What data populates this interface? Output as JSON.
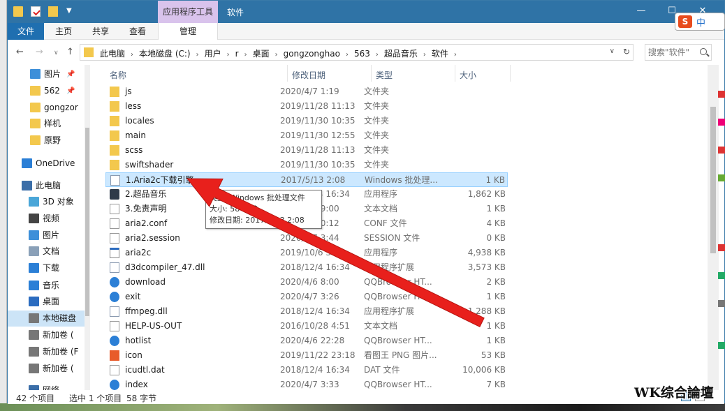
{
  "window": {
    "title": "软件",
    "context_tab": "应用程序工具",
    "minimize_glyph": "—",
    "maximize_glyph": "☐",
    "close_glyph": "✕"
  },
  "ribbon": {
    "tabs": [
      "文件",
      "主页",
      "共享",
      "查看",
      "管理"
    ]
  },
  "ime": {
    "logo": "S",
    "lang": "中"
  },
  "nav": {
    "back": "←",
    "forward": "→",
    "recent": "∨",
    "up": "↑",
    "refresh": "↻",
    "dropdown": "∨"
  },
  "address": {
    "crumbs": [
      "此电脑",
      "本地磁盘 (C:)",
      "用户",
      "r",
      "桌面",
      "gongzonghao",
      "563",
      "超品音乐",
      "软件"
    ],
    "separator": "›"
  },
  "search": {
    "placeholder": "搜索\"软件\""
  },
  "navpane": [
    {
      "label": "图片",
      "pinned": true,
      "icon": "pictures-icon"
    },
    {
      "label": "562",
      "pinned": true,
      "icon": "folder-icon"
    },
    {
      "label": "gongzor",
      "pinned": false,
      "icon": "folder-icon"
    },
    {
      "label": "样机",
      "pinned": false,
      "icon": "folder-icon"
    },
    {
      "label": "原野",
      "pinned": false,
      "icon": "folder-icon"
    },
    {
      "label": "OneDrive",
      "pinned": false,
      "icon": "cloud-icon"
    },
    {
      "label": "此电脑",
      "pinned": false,
      "icon": "computer-icon"
    },
    {
      "label": "3D 对象",
      "pinned": false,
      "icon": "cube-icon"
    },
    {
      "label": "视频",
      "pinned": false,
      "icon": "video-icon"
    },
    {
      "label": "图片",
      "pinned": false,
      "icon": "pictures-icon"
    },
    {
      "label": "文档",
      "pinned": false,
      "icon": "documents-icon"
    },
    {
      "label": "下载",
      "pinned": false,
      "icon": "download-icon"
    },
    {
      "label": "音乐",
      "pinned": false,
      "icon": "music-icon"
    },
    {
      "label": "桌面",
      "pinned": false,
      "icon": "desktop-icon"
    },
    {
      "label": "本地磁盘",
      "pinned": false,
      "icon": "drive-icon"
    },
    {
      "label": "新加卷 (",
      "pinned": false,
      "icon": "drive-icon"
    },
    {
      "label": "新加卷 (F",
      "pinned": false,
      "icon": "drive-icon"
    },
    {
      "label": "新加卷 (",
      "pinned": false,
      "icon": "drive-icon"
    },
    {
      "label": "网络",
      "pinned": false,
      "icon": "network-icon"
    }
  ],
  "pin_glyph": "📌",
  "columns": {
    "name": "名称",
    "date": "修改日期",
    "type": "类型",
    "size": "大小",
    "sort_glyph": "^"
  },
  "files": [
    {
      "name": "js",
      "date": "2020/4/7 1:19",
      "type": "文件夹",
      "size": "",
      "icon": "folder"
    },
    {
      "name": "less",
      "date": "2019/11/28 11:13",
      "type": "文件夹",
      "size": "",
      "icon": "folder"
    },
    {
      "name": "locales",
      "date": "2019/11/30 10:35",
      "type": "文件夹",
      "size": "",
      "icon": "folder"
    },
    {
      "name": "main",
      "date": "2019/11/30 12:55",
      "type": "文件夹",
      "size": "",
      "icon": "folder"
    },
    {
      "name": "scss",
      "date": "2019/11/28 11:13",
      "type": "文件夹",
      "size": "",
      "icon": "folder"
    },
    {
      "name": "swiftshader",
      "date": "2019/11/30 10:35",
      "type": "文件夹",
      "size": "",
      "icon": "folder"
    },
    {
      "name": "1.Aria2c下载引擎",
      "date": "2017/5/13 2:08",
      "type": "Windows 批处理...",
      "size": "1 KB",
      "icon": "bat",
      "selected": true
    },
    {
      "name": "2.超品音乐",
      "date": "2018/12/4 16:34",
      "type": "应用程序",
      "size": "1,862 KB",
      "icon": "exe"
    },
    {
      "name": "3.免责声明",
      "date": "2020/4/7 9:00",
      "type": "文本文档",
      "size": "1 KB",
      "icon": "doc"
    },
    {
      "name": "aria2.conf",
      "date": "2020/4/7 0:12",
      "type": "CONF 文件",
      "size": "4 KB",
      "icon": "doc"
    },
    {
      "name": "aria2.session",
      "date": "2020/4/7 3:44",
      "type": "SESSION 文件",
      "size": "0 KB",
      "icon": "doc"
    },
    {
      "name": "aria2c",
      "date": "2019/10/6 3:51",
      "type": "应用程序",
      "size": "4,938 KB",
      "icon": "app"
    },
    {
      "name": "d3dcompiler_47.dll",
      "date": "2018/12/4 16:34",
      "type": "应用程序扩展",
      "size": "3,573 KB",
      "icon": "bat"
    },
    {
      "name": "download",
      "date": "2020/4/6 8:00",
      "type": "QQBrowser HT...",
      "size": "2 KB",
      "icon": "ie"
    },
    {
      "name": "exit",
      "date": "2020/4/7 3:26",
      "type": "QQBrowser HT...",
      "size": "1 KB",
      "icon": "ie"
    },
    {
      "name": "ffmpeg.dll",
      "date": "2018/12/4 16:34",
      "type": "应用程序扩展",
      "size": "1,288 KB",
      "icon": "bat"
    },
    {
      "name": "HELP-US-OUT",
      "date": "2016/10/28 4:51",
      "type": "文本文档",
      "size": "1 KB",
      "icon": "doc"
    },
    {
      "name": "hotlist",
      "date": "2020/4/6 22:28",
      "type": "QQBrowser HT...",
      "size": "1 KB",
      "icon": "ie"
    },
    {
      "name": "icon",
      "date": "2019/11/22 23:18",
      "type": "看图王 PNG 图片...",
      "size": "53 KB",
      "icon": "png"
    },
    {
      "name": "icudtl.dat",
      "date": "2018/12/4 16:34",
      "type": "DAT 文件",
      "size": "10,006 KB",
      "icon": "doc"
    },
    {
      "name": "index",
      "date": "2020/4/7 3:33",
      "type": "QQBrowser HT...",
      "size": "7 KB",
      "icon": "ie"
    }
  ],
  "tooltip": {
    "line1": "类型: Windows 批处理文件",
    "line2": "大小: 58 字节",
    "line3": "修改日期: 2017/5/13 2:08"
  },
  "status": {
    "count": "42 个项目",
    "selected": "选中 1 个项目",
    "size": "58 字节"
  },
  "watermark": "WK综合論壇",
  "annotation_color": "#e8201c"
}
